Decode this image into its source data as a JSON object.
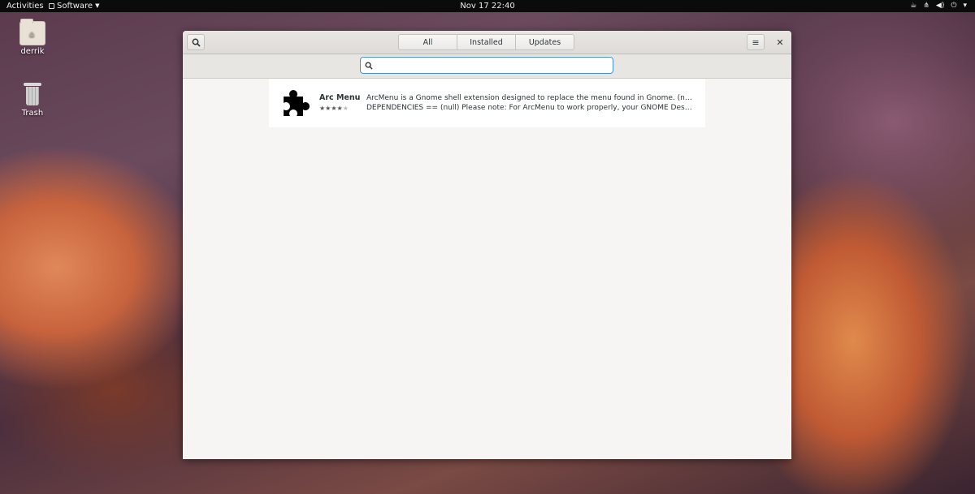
{
  "topbar": {
    "activities": "Activities",
    "app_name": "Software",
    "clock": "Nov 17  22:40"
  },
  "desktop": {
    "icons": [
      {
        "label": "derrik",
        "icon": "home-folder-icon"
      },
      {
        "label": "Trash",
        "icon": "trash-icon"
      }
    ]
  },
  "window": {
    "tabs": [
      "All",
      "Installed",
      "Updates"
    ],
    "search": {
      "value": "",
      "placeholder": ""
    },
    "results": [
      {
        "name": "Arc Menu",
        "rating_stars": 4,
        "rating_max": 5,
        "icon": "puzzle-piece-icon",
        "description_line1": "ArcMenu is a Gnome shell extension designed to replace the menu found in Gnome.  (null)  ==",
        "description_line2": "DEPENDENCIES ==  (null)  Please note: For ArcMenu to work properly, your GNOME Desktop m..."
      }
    ]
  },
  "colors": {
    "accent": "#4a90d9",
    "topbar": "#0b0b0b"
  }
}
